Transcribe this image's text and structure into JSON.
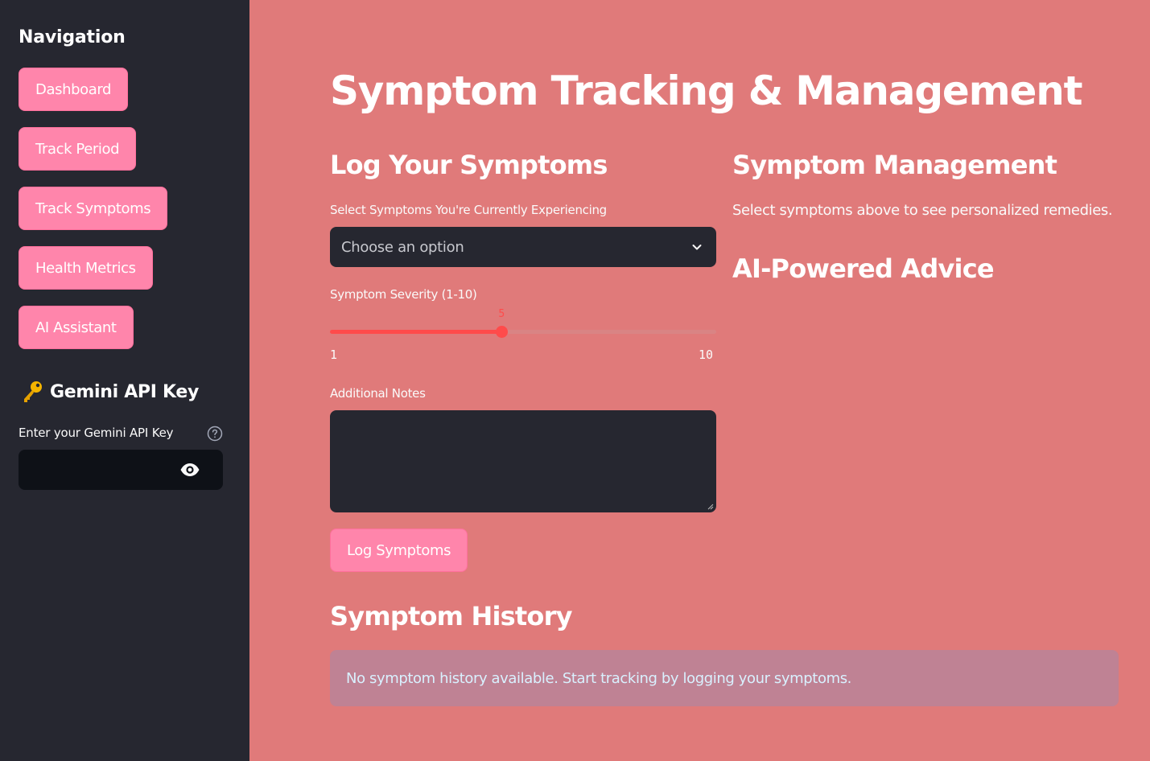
{
  "sidebar": {
    "title": "Navigation",
    "items": [
      {
        "label": "Dashboard"
      },
      {
        "label": "Track Period"
      },
      {
        "label": "Track Symptoms"
      },
      {
        "label": "Health Metrics"
      },
      {
        "label": "AI Assistant"
      }
    ],
    "api_key": {
      "icon": "key-icon",
      "title": "Gemini API Key",
      "input_label": "Enter your Gemini API Key",
      "value": ""
    }
  },
  "main": {
    "title": "Symptom Tracking & Management",
    "log": {
      "heading": "Log Your Symptoms",
      "select_label": "Select Symptoms You're Currently Experiencing",
      "select_placeholder": "Choose an option",
      "severity_label": "Symptom Severity (1-10)",
      "severity_value": "5",
      "severity_min": "1",
      "severity_max": "10",
      "notes_label": "Additional Notes",
      "notes_value": "",
      "submit_label": "Log Symptoms"
    },
    "management": {
      "heading": "Symptom Management",
      "description": "Select symptoms above to see personalized remedies.",
      "ai_heading": "AI-Powered Advice"
    },
    "history": {
      "heading": "Symptom History",
      "empty_message": "No symptom history available. Start tracking by logging your symptoms."
    }
  },
  "colors": {
    "background": "#e07a7a",
    "sidebar": "#262730",
    "button": "#ff85ab",
    "slider": "#ff4b4b",
    "info_box": "#bf8294"
  }
}
